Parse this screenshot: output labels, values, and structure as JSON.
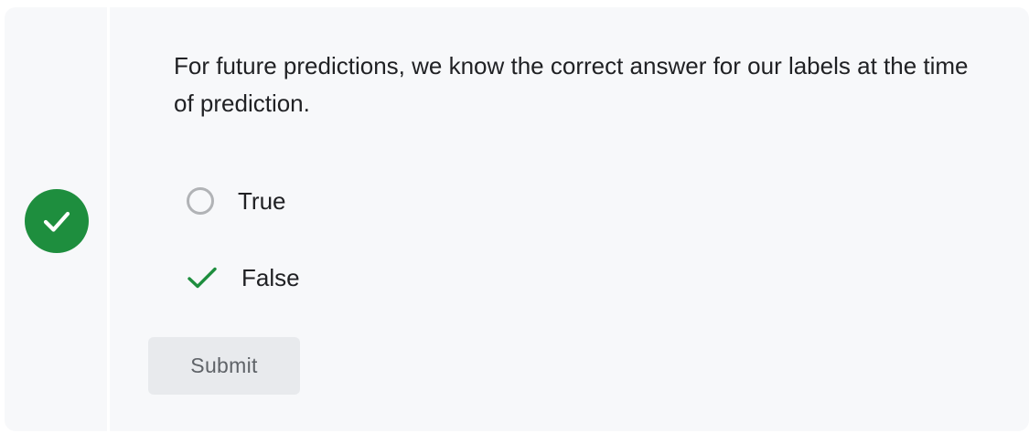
{
  "quiz": {
    "question": "For future predictions, we know the correct answer for our labels at the time of prediction.",
    "status_icon": "check-circle-icon",
    "status_color": "#1e8e3e",
    "options": [
      {
        "label": "True",
        "state": "unselected",
        "icon": "radio-icon"
      },
      {
        "label": "False",
        "state": "correct",
        "icon": "check-icon"
      }
    ],
    "submit_label": "Submit",
    "submit_enabled": false
  }
}
